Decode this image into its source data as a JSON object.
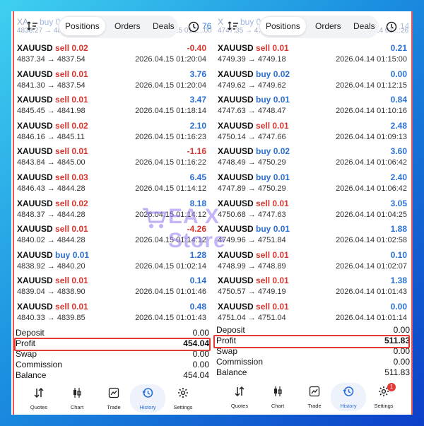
{
  "left_panel": {
    "ghost_top": "XA",
    "ghost_top2": "buy 0",
    "ghost_prices": "4838.27 → 4840.",
    "ghost_time": "2026.04.15 01:2...00",
    "tabs": [
      "Positions",
      "Orders",
      "Deals"
    ],
    "active_tab": "Positions",
    "badge": "76",
    "trades": [
      {
        "symbol": "XAUUSD",
        "dir": "sell",
        "vol": "0.02",
        "prices": "4837.34 → 4837.54",
        "profit": "-0.40",
        "time": "2026.04.15 01:20:04"
      },
      {
        "symbol": "XAUUSD",
        "dir": "sell",
        "vol": "0.01",
        "prices": "4841.30 → 4837.54",
        "profit": "3.76",
        "time": "2026.04.15 01:20:04"
      },
      {
        "symbol": "XAUUSD",
        "dir": "sell",
        "vol": "0.01",
        "prices": "4845.45 → 4841.98",
        "profit": "3.47",
        "time": "2026.04.15 01:18:14"
      },
      {
        "symbol": "XAUUSD",
        "dir": "sell",
        "vol": "0.02",
        "prices": "4846.16 → 4845.11",
        "profit": "2.10",
        "time": "2026.04.15 01:16:23"
      },
      {
        "symbol": "XAUUSD",
        "dir": "sell",
        "vol": "0.01",
        "prices": "4843.84 → 4845.00",
        "profit": "-1.16",
        "time": "2026.04.15 01:16:22"
      },
      {
        "symbol": "XAUUSD",
        "dir": "sell",
        "vol": "0.03",
        "prices": "4846.43 → 4844.28",
        "profit": "6.45",
        "time": "2026.04.15 01:14:12"
      },
      {
        "symbol": "XAUUSD",
        "dir": "sell",
        "vol": "0.02",
        "prices": "4848.37 → 4844.28",
        "profit": "8.18",
        "time": "2026.04.15 01:14:12"
      },
      {
        "symbol": "XAUUSD",
        "dir": "sell",
        "vol": "0.01",
        "prices": "4840.02 → 4844.28",
        "profit": "-4.26",
        "time": "2026.04.15 01:14:12"
      },
      {
        "symbol": "XAUUSD",
        "dir": "buy",
        "vol": "0.01",
        "prices": "4838.92 → 4840.20",
        "profit": "1.28",
        "time": "2026.04.15 01:02:14"
      },
      {
        "symbol": "XAUUSD",
        "dir": "sell",
        "vol": "0.01",
        "prices": "4839.04 → 4838.90",
        "profit": "0.14",
        "time": "2026.04.15 01:01:46"
      },
      {
        "symbol": "XAUUSD",
        "dir": "sell",
        "vol": "0.01",
        "prices": "4840.33 → 4839.85",
        "profit": "0.48",
        "time": "2026.04.15 01:01:43"
      }
    ],
    "summary": [
      {
        "label": "Deposit",
        "value": "0.00"
      },
      {
        "label": "Profit",
        "value": "454.04"
      },
      {
        "label": "Swap",
        "value": "0.00"
      },
      {
        "label": "Commission",
        "value": "0.00"
      },
      {
        "label": "Balance",
        "value": "454.04"
      }
    ]
  },
  "right_panel": {
    "ghost_top": "X",
    "ghost_top2": "buy 0",
    "ghost_prices": "4747.35 → 4746.",
    "ghost_time": "2026.04.14 01:..:26",
    "tabs": [
      "Positions",
      "Orders",
      "Deals"
    ],
    "active_tab": "Positions",
    "badge": "14",
    "trades": [
      {
        "symbol": "XAUUSD",
        "dir": "sell",
        "vol": "0.01",
        "prices": "4749.39 → 4749.18",
        "profit": "0.21",
        "time": "2026.04.14 01:15:00"
      },
      {
        "symbol": "XAUUSD",
        "dir": "buy",
        "vol": "0.02",
        "prices": "4749.62 → 4749.62",
        "profit": "0.00",
        "time": "2026.04.14 01:12:15"
      },
      {
        "symbol": "XAUUSD",
        "dir": "buy",
        "vol": "0.01",
        "prices": "4747.63 → 4748.47",
        "profit": "0.84",
        "time": "2026.04.14 01:10:16"
      },
      {
        "symbol": "XAUUSD",
        "dir": "sell",
        "vol": "0.01",
        "prices": "4750.14 → 4747.66",
        "profit": "2.48",
        "time": "2026.04.14 01:09:13"
      },
      {
        "symbol": "XAUUSD",
        "dir": "buy",
        "vol": "0.02",
        "prices": "4748.49 → 4750.29",
        "profit": "3.60",
        "time": "2026.04.14 01:06:42"
      },
      {
        "symbol": "XAUUSD",
        "dir": "buy",
        "vol": "0.01",
        "prices": "4747.89 → 4750.29",
        "profit": "2.40",
        "time": "2026.04.14 01:06:42"
      },
      {
        "symbol": "XAUUSD",
        "dir": "sell",
        "vol": "0.01",
        "prices": "4750.68 → 4747.63",
        "profit": "3.05",
        "time": "2026.04.14 01:04:25"
      },
      {
        "symbol": "XAUUSD",
        "dir": "buy",
        "vol": "0.01",
        "prices": "4749.96 → 4751.84",
        "profit": "1.88",
        "time": "2026.04.14 01:02:58"
      },
      {
        "symbol": "XAUUSD",
        "dir": "sell",
        "vol": "0.01",
        "prices": "4748.99 → 4748.89",
        "profit": "0.10",
        "time": "2026.04.14 01:02:07"
      },
      {
        "symbol": "XAUUSD",
        "dir": "sell",
        "vol": "0.01",
        "prices": "4750.57 → 4749.19",
        "profit": "1.38",
        "time": "2026.04.14 01:01:43"
      },
      {
        "symbol": "XAUUSD",
        "dir": "sell",
        "vol": "0.01",
        "prices": "4751.04 → 4751.04",
        "profit": "0.00",
        "time": "2026.04.14 01:01:14"
      }
    ],
    "summary": [
      {
        "label": "Deposit",
        "value": "0.00"
      },
      {
        "label": "Profit",
        "value": "511.83"
      },
      {
        "label": "Swap",
        "value": "0.00"
      },
      {
        "label": "Commission",
        "value": "0.00"
      },
      {
        "label": "Balance",
        "value": "511.83"
      }
    ]
  },
  "nav": {
    "items": [
      {
        "label": "Quotes",
        "icon": "quotes-arrows-icon"
      },
      {
        "label": "Chart",
        "icon": "candlestick-icon"
      },
      {
        "label": "Trade",
        "icon": "trade-chart-icon"
      },
      {
        "label": "History",
        "icon": "history-clock-icon"
      },
      {
        "label": "Settings",
        "icon": "gear-icon"
      }
    ],
    "active": "History",
    "settings_notification": "1"
  },
  "watermark": {
    "text": "EA X Store"
  },
  "colors": {
    "buy": "#2a6fd6",
    "sell": "#d7352f",
    "highlight": "#e53935"
  }
}
